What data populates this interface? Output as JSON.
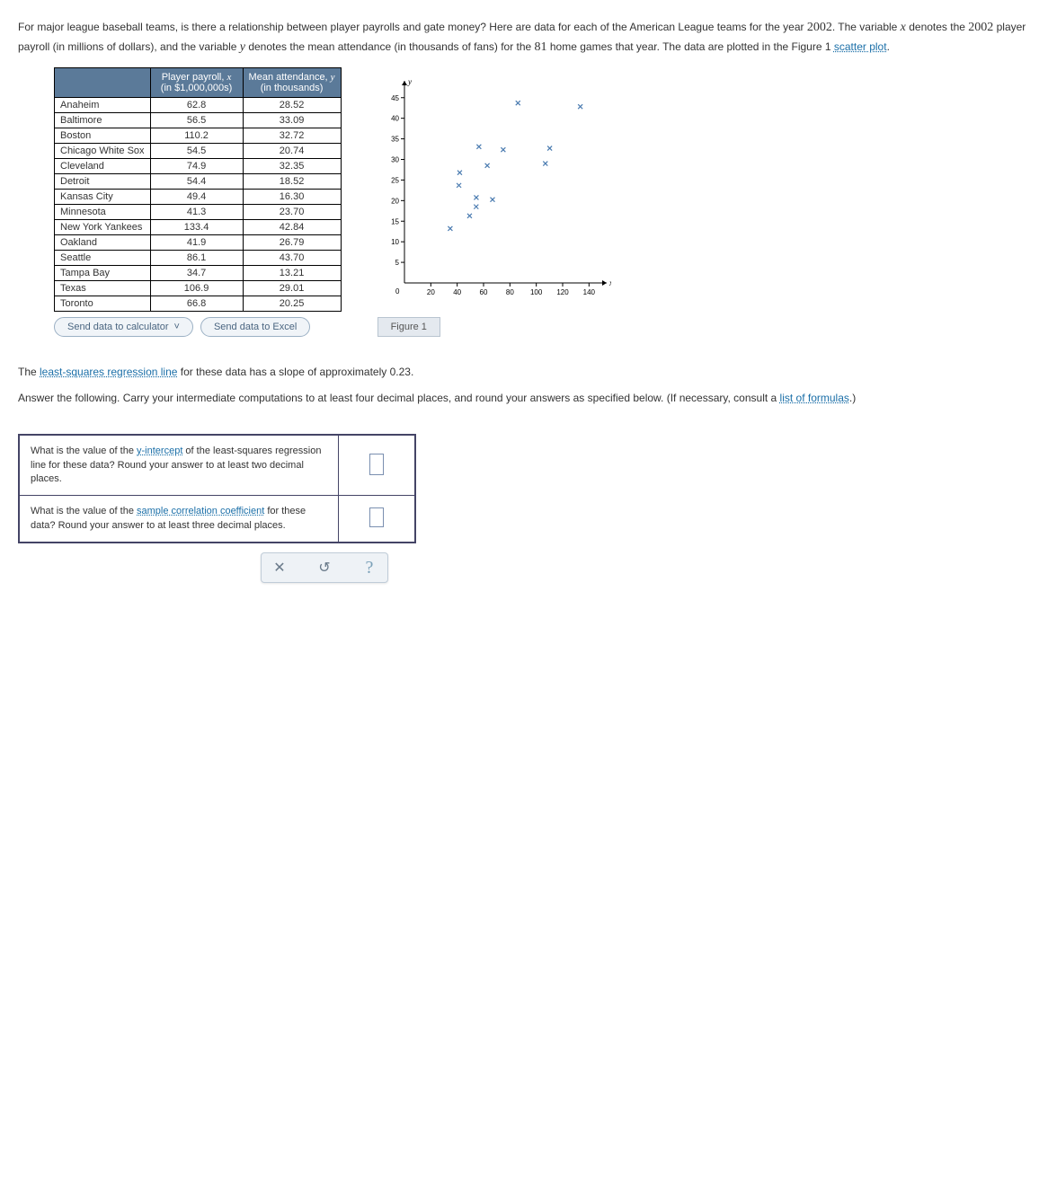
{
  "intro": {
    "text1": "For major league baseball teams, is there a relationship between player payrolls and gate money? Here are data for each of the American League teams for the year ",
    "year": "2002",
    "text2": ". The variable ",
    "varx": "x",
    "text3": " denotes the ",
    "text4": " player payroll (in millions of dollars), and the variable ",
    "vary": "y",
    "text5": " denotes the mean attendance (in thousands of fans) for the ",
    "games": "81",
    "text6": " home games that year. The data are plotted in the Figure 1 ",
    "scatter_link": "scatter plot",
    "period": "."
  },
  "table": {
    "headers": {
      "team": "",
      "x": "Player payroll, x (in $1,000,000s)",
      "y": "Mean attendance, y (in thousands)"
    },
    "rows": [
      {
        "team": "Anaheim",
        "x": "62.8",
        "y": "28.52"
      },
      {
        "team": "Baltimore",
        "x": "56.5",
        "y": "33.09"
      },
      {
        "team": "Boston",
        "x": "110.2",
        "y": "32.72"
      },
      {
        "team": "Chicago White Sox",
        "x": "54.5",
        "y": "20.74"
      },
      {
        "team": "Cleveland",
        "x": "74.9",
        "y": "32.35"
      },
      {
        "team": "Detroit",
        "x": "54.4",
        "y": "18.52"
      },
      {
        "team": "Kansas City",
        "x": "49.4",
        "y": "16.30"
      },
      {
        "team": "Minnesota",
        "x": "41.3",
        "y": "23.70"
      },
      {
        "team": "New York Yankees",
        "x": "133.4",
        "y": "42.84"
      },
      {
        "team": "Oakland",
        "x": "41.9",
        "y": "26.79"
      },
      {
        "team": "Seattle",
        "x": "86.1",
        "y": "43.70"
      },
      {
        "team": "Tampa Bay",
        "x": "34.7",
        "y": "13.21"
      },
      {
        "team": "Texas",
        "x": "106.9",
        "y": "29.01"
      },
      {
        "team": "Toronto",
        "x": "66.8",
        "y": "20.25"
      }
    ]
  },
  "buttons": {
    "calc": "Send data to calculator",
    "excel": "Send data to Excel"
  },
  "chart_data": {
    "type": "scatter",
    "title": "",
    "xlabel": "x",
    "ylabel": "y",
    "xlim": [
      0,
      150
    ],
    "ylim": [
      0,
      48
    ],
    "xticks": [
      20,
      40,
      60,
      80,
      100,
      120,
      140
    ],
    "yticks": [
      5,
      10,
      15,
      20,
      25,
      30,
      35,
      40,
      45
    ],
    "series": [
      {
        "name": "teams",
        "points": [
          {
            "x": 62.8,
            "y": 28.52
          },
          {
            "x": 56.5,
            "y": 33.09
          },
          {
            "x": 110.2,
            "y": 32.72
          },
          {
            "x": 54.5,
            "y": 20.74
          },
          {
            "x": 74.9,
            "y": 32.35
          },
          {
            "x": 54.4,
            "y": 18.52
          },
          {
            "x": 49.4,
            "y": 16.3
          },
          {
            "x": 41.3,
            "y": 23.7
          },
          {
            "x": 133.4,
            "y": 42.84
          },
          {
            "x": 41.9,
            "y": 26.79
          },
          {
            "x": 86.1,
            "y": 43.7
          },
          {
            "x": 34.7,
            "y": 13.21
          },
          {
            "x": 106.9,
            "y": 29.01
          },
          {
            "x": 66.8,
            "y": 20.25
          }
        ]
      }
    ]
  },
  "figure_label": "Figure 1",
  "slope": {
    "pre": "The ",
    "link": "least-squares regression line",
    "post": " for these data has a slope of approximately ",
    "value": "0.23",
    "period": "."
  },
  "instructions": {
    "text1": "Answer the following. Carry your intermediate computations to at least four decimal places, and round your answers as specified below. (If necessary, consult a ",
    "link": "list of formulas",
    "text2": ".)"
  },
  "questions": {
    "q1": {
      "pre": "What is the value of the ",
      "link": "y-intercept",
      "post": " of the least-squares regression line for these data? Round your answer to at least two decimal places."
    },
    "q2": {
      "pre": "What is the value of the ",
      "link": "sample correlation coefficient",
      "post": " for these data? Round your answer to at least three decimal places."
    }
  },
  "actions": {
    "clear": "✕",
    "reset": "↺",
    "help": "?"
  }
}
